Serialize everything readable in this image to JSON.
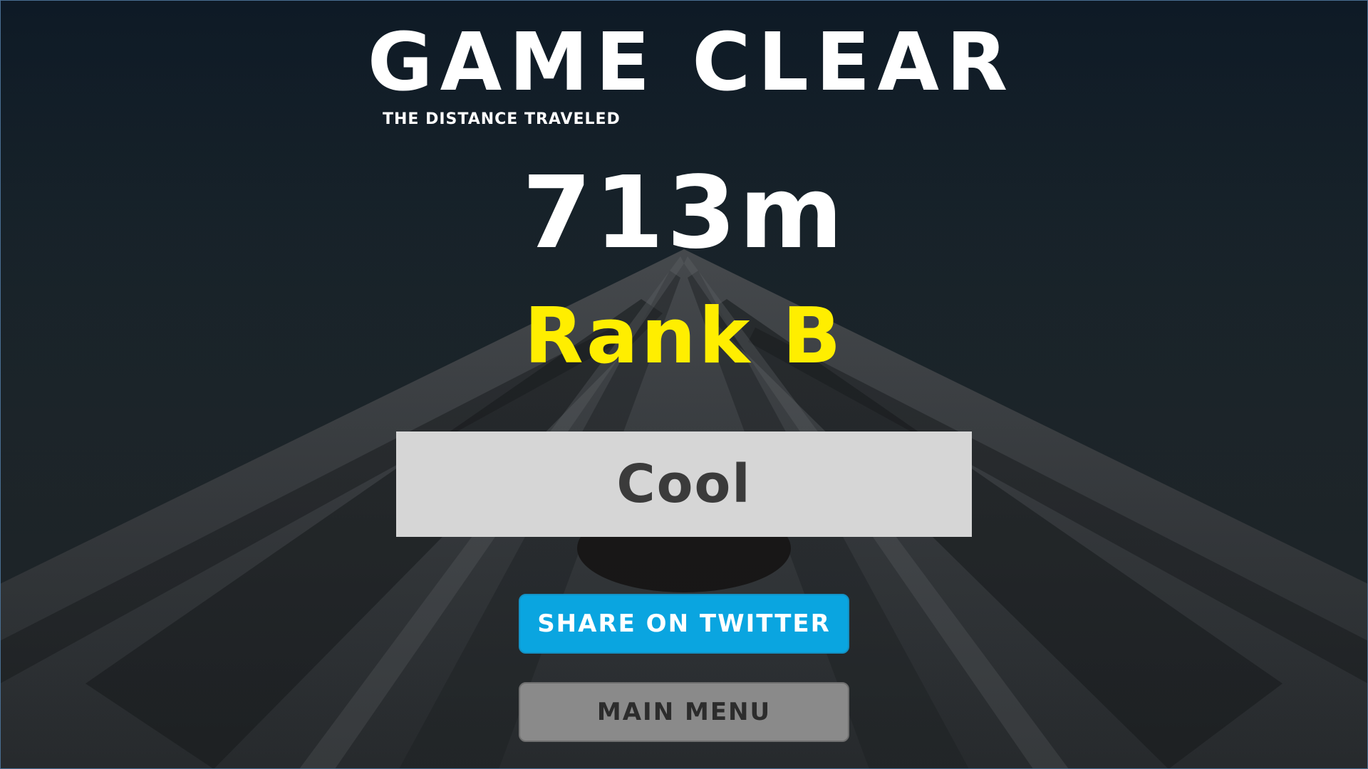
{
  "screen": {
    "title": "GAME CLEAR",
    "subtitle": "THE DISTANCE TRAVELED",
    "distance": "713m",
    "rank": "Rank B",
    "comment": "Cool"
  },
  "buttons": {
    "twitter_label": "SHARE ON TWITTER",
    "menu_label": "MAIN MENU"
  },
  "colors": {
    "rank": "#ffee00",
    "twitter": "#0aa5e0",
    "menu": "#8a8a8a",
    "comment_bg": "#d6d6d6"
  }
}
